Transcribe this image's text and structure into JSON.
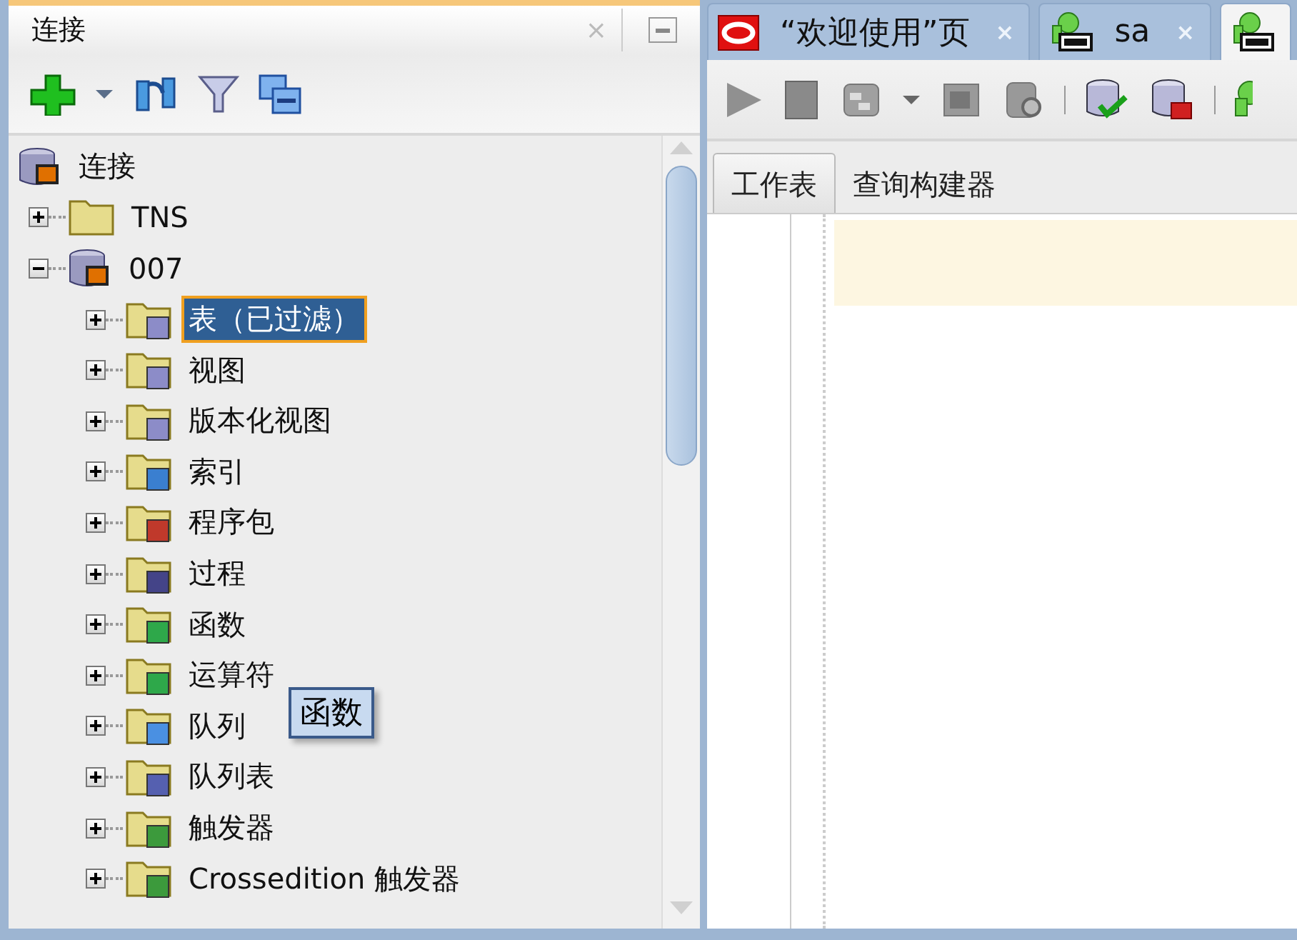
{
  "left_panel": {
    "title": "连接",
    "close": "×",
    "tree": {
      "label": "连接",
      "kind": "connections",
      "selected": false,
      "children": [
        {
          "label": "TNS",
          "kind": "folder",
          "expanded": false,
          "selected": false
        },
        {
          "label": "007",
          "kind": "database",
          "expanded": true,
          "selected": false,
          "children": [
            {
              "label": "表（已过滤）",
              "kind": "tables",
              "expanded": false,
              "selected": true
            },
            {
              "label": "视图",
              "kind": "views",
              "expanded": false,
              "selected": false
            },
            {
              "label": "版本化视图",
              "kind": "views",
              "expanded": false,
              "selected": false
            },
            {
              "label": "索引",
              "kind": "indexes",
              "expanded": false,
              "selected": false
            },
            {
              "label": "程序包",
              "kind": "packages",
              "expanded": false,
              "selected": false
            },
            {
              "label": "过程",
              "kind": "procedures",
              "expanded": false,
              "selected": false
            },
            {
              "label": "函数",
              "kind": "functions",
              "expanded": false,
              "selected": false
            },
            {
              "label": "运算符",
              "kind": "operators",
              "expanded": false,
              "selected": false
            },
            {
              "label": "队列",
              "kind": "queues",
              "expanded": false,
              "selected": false
            },
            {
              "label": "队列表",
              "kind": "queue-tables",
              "expanded": false,
              "selected": false
            },
            {
              "label": "触发器",
              "kind": "triggers",
              "expanded": false,
              "selected": false
            },
            {
              "label": "Crossedition 触发器",
              "kind": "triggers",
              "expanded": false,
              "selected": false
            }
          ]
        }
      ]
    },
    "tooltip": "函数"
  },
  "editor_tabs": [
    {
      "label": "“欢迎使用”页",
      "kind": "welcome",
      "close": "×",
      "selected": false
    },
    {
      "label": "sa",
      "kind": "sql",
      "close": "×",
      "selected": false
    },
    {
      "kind": "sql",
      "selected": true
    }
  ],
  "sub_tabs": [
    {
      "label": "工作表",
      "selected": true
    },
    {
      "label": "查询构建器",
      "selected": false
    }
  ]
}
